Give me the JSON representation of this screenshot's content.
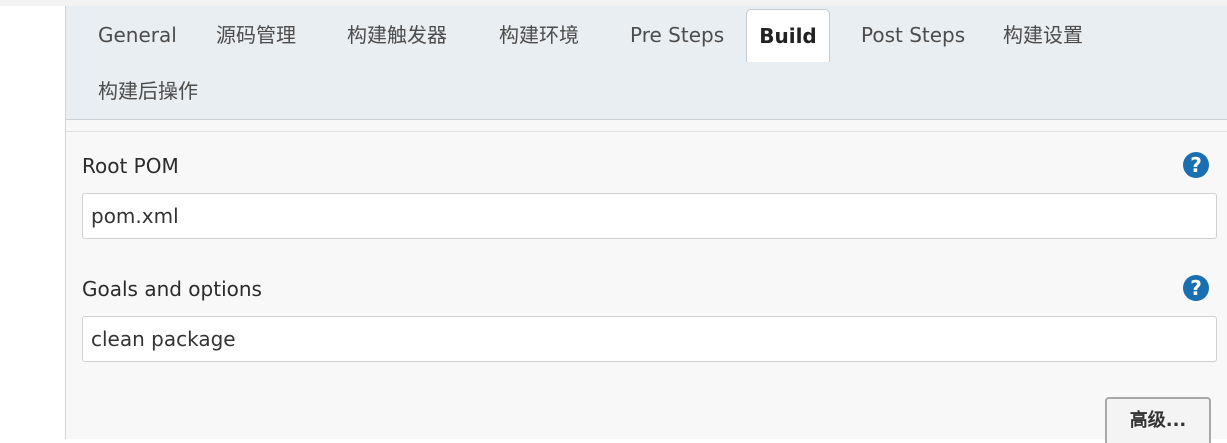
{
  "tabs": [
    {
      "label": "General",
      "active": false
    },
    {
      "label": "源码管理",
      "active": false
    },
    {
      "label": "构建触发器",
      "active": false
    },
    {
      "label": "构建环境",
      "active": false
    },
    {
      "label": "Pre Steps",
      "active": false
    },
    {
      "label": "Build",
      "active": true
    },
    {
      "label": "Post Steps",
      "active": false
    },
    {
      "label": "构建设置",
      "active": false
    },
    {
      "label": "构建后操作",
      "active": false
    }
  ],
  "fields": {
    "root_pom": {
      "label": "Root POM",
      "value": "pom.xml"
    },
    "goals": {
      "label": "Goals and options",
      "value": "clean package"
    }
  },
  "help_icon_glyph": "?",
  "advanced_button_label": "高级...",
  "colors": {
    "tabbar_bg": "#e9eef2",
    "help_icon": "#1a6fb0",
    "panel_bg": "#f8f8f8"
  }
}
